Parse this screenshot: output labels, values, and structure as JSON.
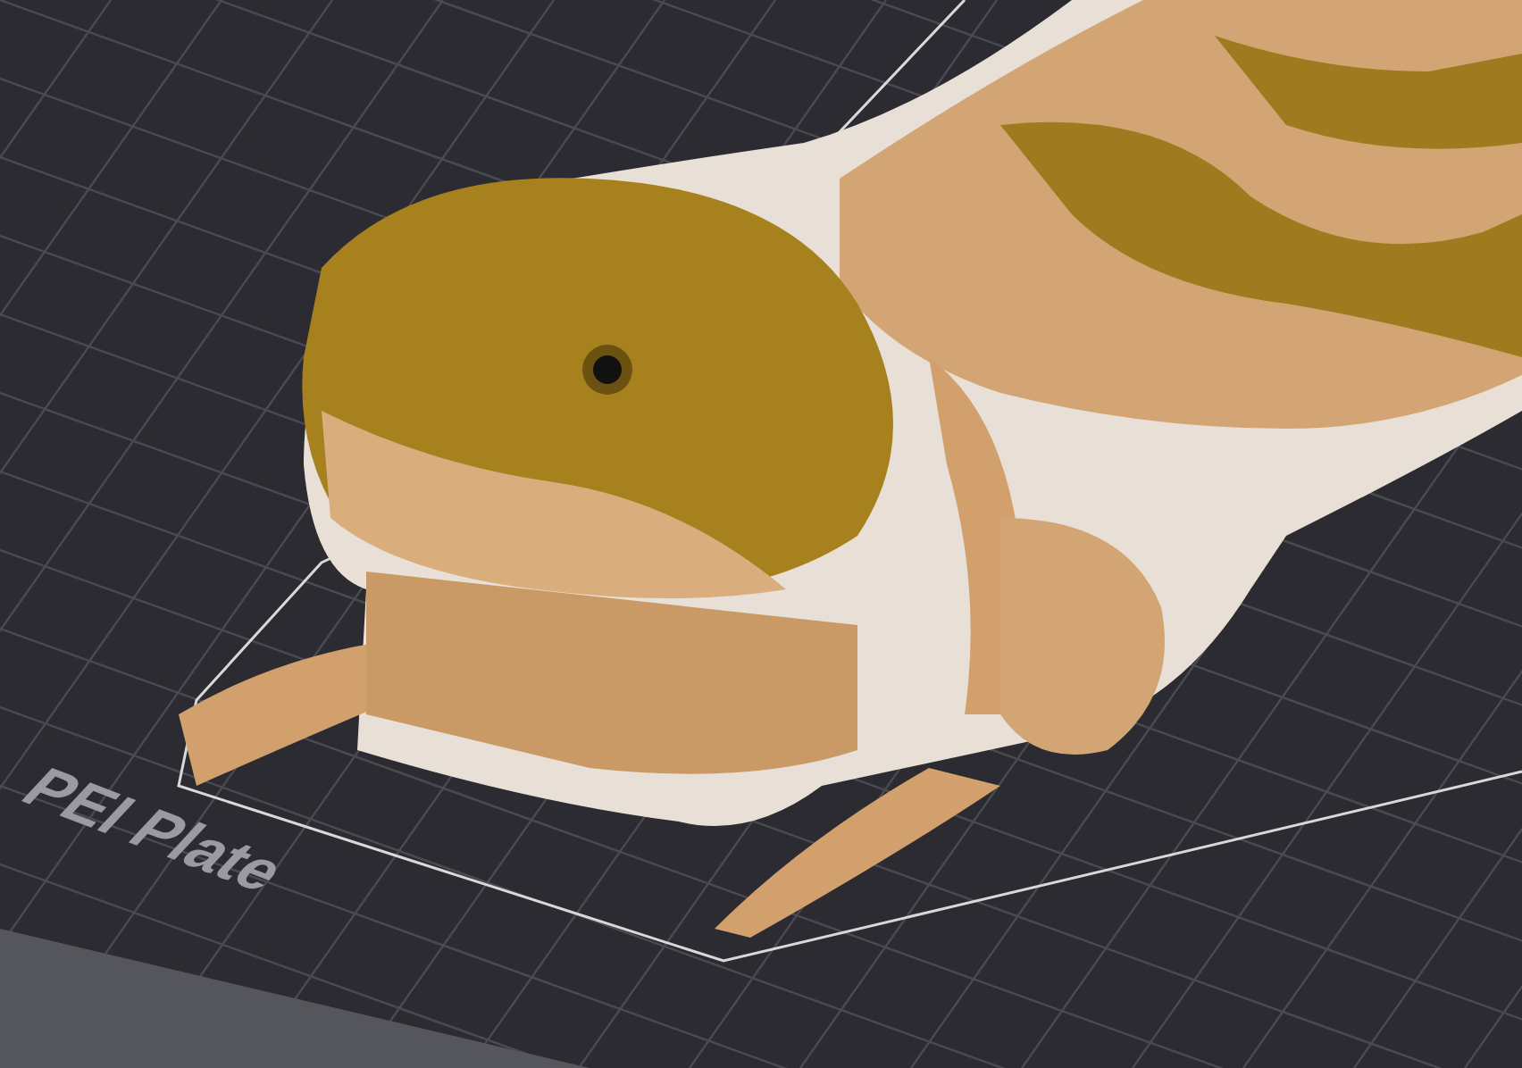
{
  "viewport": {
    "plate_label": "PEI Plate"
  }
}
